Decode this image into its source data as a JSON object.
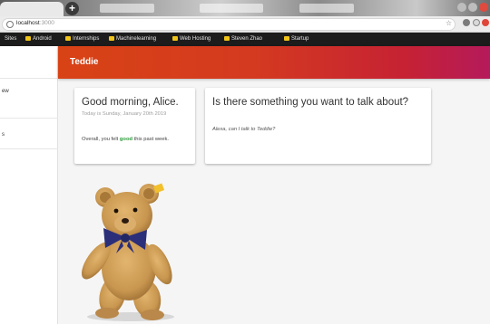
{
  "browser": {
    "new_tab_symbol": "+",
    "url_host": "localhost",
    "url_port": ":3000"
  },
  "bookmarks": [
    {
      "label": "Sites"
    },
    {
      "label": "Android"
    },
    {
      "label": "Internships"
    },
    {
      "label": "Machinelearning"
    },
    {
      "label": "Web Hosting"
    },
    {
      "label": "Steven Zhao"
    },
    {
      "label": "Startup"
    }
  ],
  "sidebar": {
    "items": [
      {
        "label": "ew"
      },
      {
        "label": "s"
      }
    ]
  },
  "app": {
    "title": "Teddie"
  },
  "greeting_card": {
    "title": "Good morning, Alice.",
    "date_line": "Today is Sunday, January 20th 2019",
    "mood_prefix": "Overall, you felt ",
    "mood_word": "good",
    "mood_suffix": " this past week."
  },
  "talk_card": {
    "title": "Is there something you want to talk about?",
    "hint": "Alexa, can I talk to Teddie?"
  },
  "colors": {
    "appbar_start": "#d84315",
    "appbar_end": "#b51a5b",
    "mood_good": "#2e9e3a",
    "teddy_fur": "#c8964f",
    "teddy_bow": "#2b2f7a"
  },
  "images": {
    "mascot": "teddy-bear"
  }
}
